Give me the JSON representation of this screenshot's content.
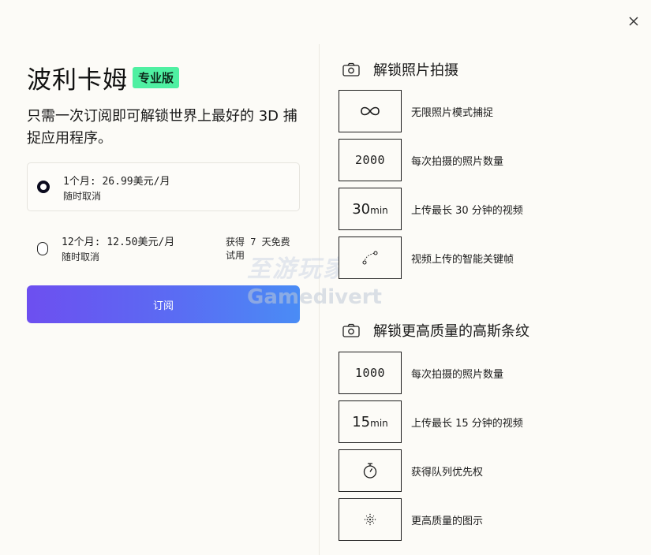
{
  "colors": {
    "background": "#fcfbf7",
    "badge": "#4ff0a2",
    "button_gradient_start": "#6d4ff0",
    "button_gradient_end": "#4a8cf5"
  },
  "header": {
    "title": "波利卡姆",
    "badge": "专业版",
    "subtitle": "只需一次订阅即可解锁世界上最好的 3D 捕捉应用程序。"
  },
  "plans": [
    {
      "price": "1个月: 26.99美元/月",
      "sub": "随时取消",
      "selected": true,
      "trial": ""
    },
    {
      "price": "12个月: 12.50美元/月",
      "sub": "随时取消",
      "selected": false,
      "trial": "获得 7 天免费试用"
    }
  ],
  "subscribe_label": "订阅",
  "watermark": {
    "top": "至游玩家",
    "bottom": "Gamedivert"
  },
  "sections": [
    {
      "title": "解锁照片拍摄",
      "icon": "camera-icon",
      "features": [
        {
          "box": "∞",
          "box_type": "infinity",
          "label": "无限照片模式捕捉"
        },
        {
          "box": "2000",
          "box_type": "number",
          "label": "每次拍摄的照片数量"
        },
        {
          "box": "30",
          "box_unit": "min",
          "box_type": "minutes",
          "label": "上传最长 30 分钟的视频"
        },
        {
          "box": "",
          "box_type": "keyframes-icon",
          "label": "视频上传的智能关键帧"
        }
      ]
    },
    {
      "title": "解锁更高质量的高斯条纹",
      "icon": "camera-icon",
      "features": [
        {
          "box": "1000",
          "box_type": "number",
          "label": "每次拍摄的照片数量"
        },
        {
          "box": "15",
          "box_unit": "min",
          "box_type": "minutes",
          "label": "上传最长 15 分钟的视频"
        },
        {
          "box": "",
          "box_type": "stopwatch-icon",
          "label": "获得队列优先权"
        },
        {
          "box": "",
          "box_type": "quality-icon",
          "label": "更高质量的图示"
        }
      ]
    }
  ]
}
